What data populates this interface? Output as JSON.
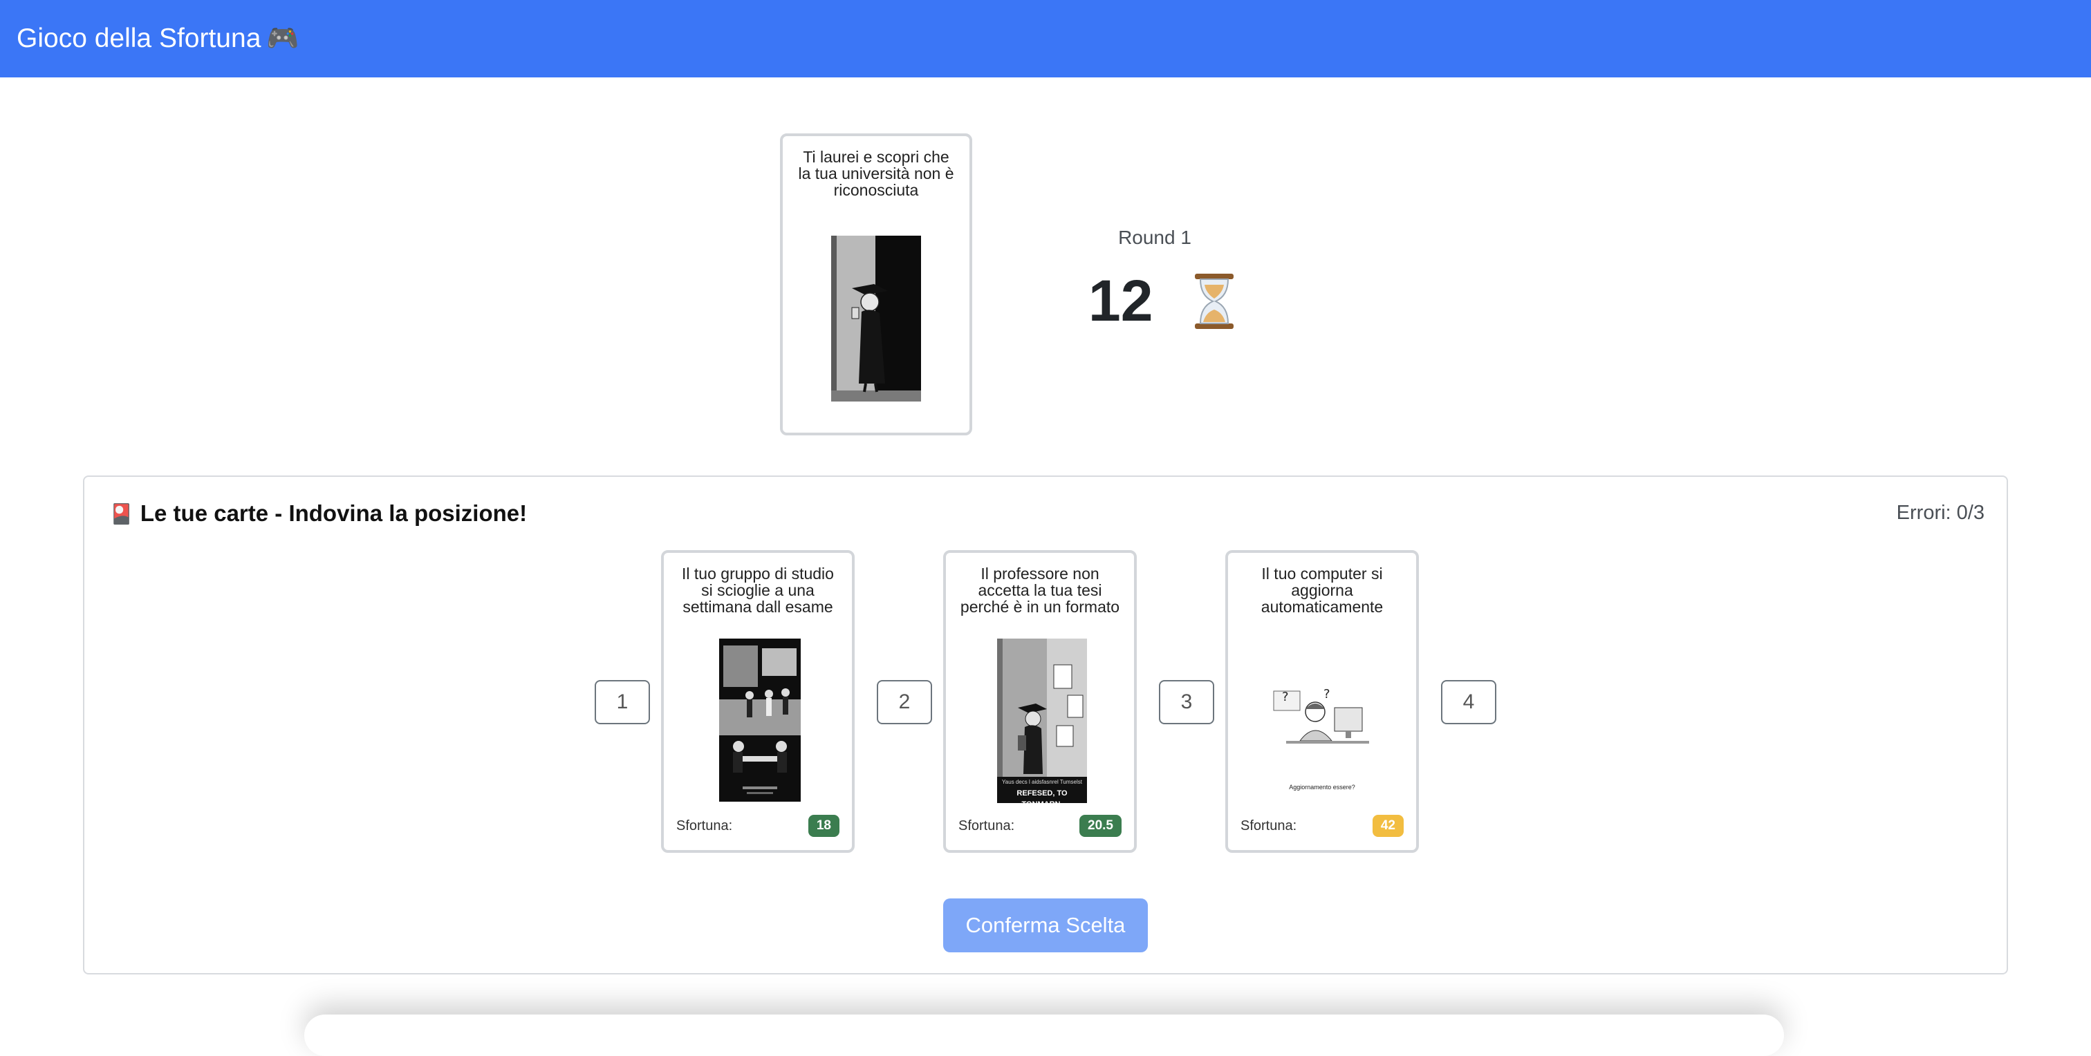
{
  "app": {
    "title": "Gioco della Sfortuna",
    "title_emoji": "🎮"
  },
  "current_card": {
    "text": "Ti laurei e scopri che la tua università non è riconosciuta",
    "image": "graduate-in-doorway-illustration"
  },
  "round": {
    "label": "Round 1",
    "timer": "12",
    "timer_icon": "hourglass-icon"
  },
  "hand": {
    "title_icon": "🎴",
    "title": "Le tue carte - Indovina la posizione!",
    "errors": "Errori: 0/3",
    "slots": [
      "1",
      "2",
      "3",
      "4"
    ],
    "cards": [
      {
        "text": "Il tuo gruppo di studio si scioglie a una settimana dall esame",
        "image": "study-group-illustration",
        "luck_label": "Sfortuna:",
        "luck_value": "18",
        "badge_color": "#3b7d4f"
      },
      {
        "text": "Il professore non accetta la tua tesi perché è in un formato sbagliato",
        "image": "student-thesis-refused-illustration",
        "image_caption_1": "Yaus decs l aidsfasnrel Tumselst",
        "image_caption_2": "REFESED, TO TONMARN.",
        "luck_label": "Sfortuna:",
        "luck_value": "20.5",
        "badge_color": "#3b7d4f"
      },
      {
        "text": "Il tuo computer si aggiorna automaticamente durante l esame",
        "image": "computer-update-illustration",
        "image_caption": "Aggiornamento essere?",
        "luck_label": "Sfortuna:",
        "luck_value": "42",
        "badge_color": "#f2bd40"
      }
    ],
    "confirm_label": "Conferma Scelta"
  }
}
